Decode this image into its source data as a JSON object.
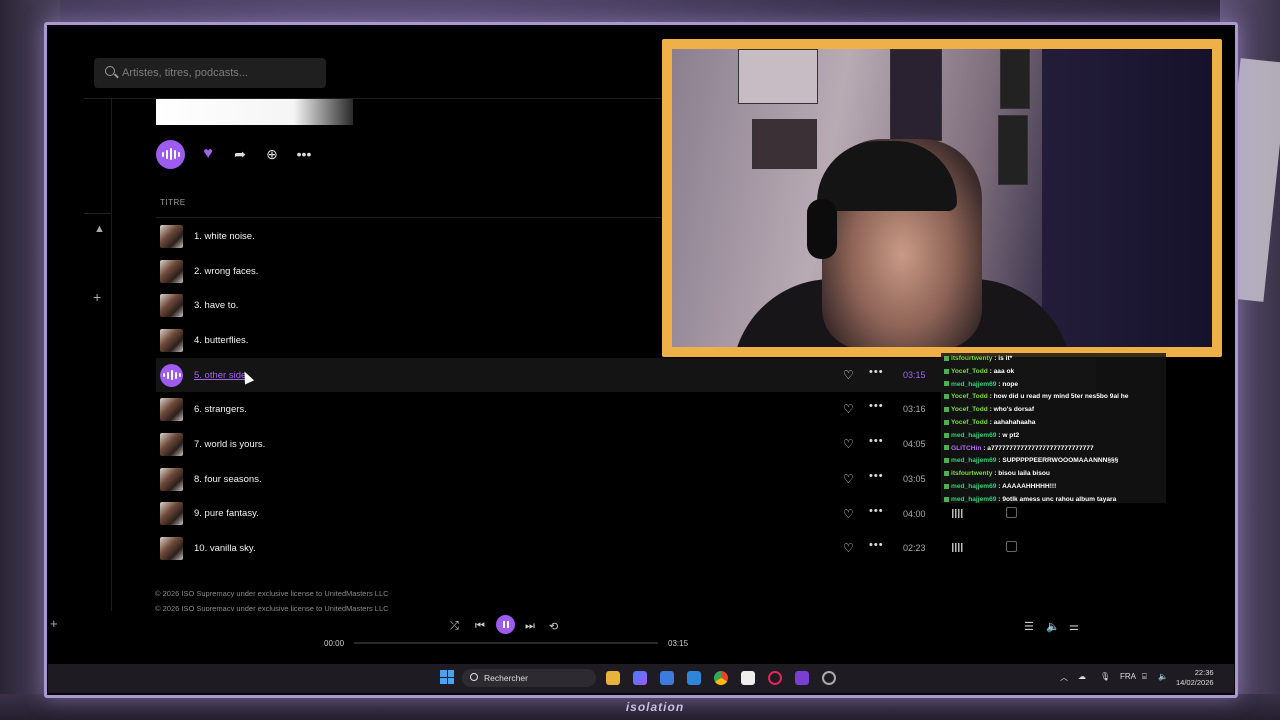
{
  "search": {
    "placeholder": "Artistes, titres, podcasts..."
  },
  "tracklist": {
    "column_title": "TITRE",
    "tracks": [
      {
        "title": "1. white noise.",
        "duration": ""
      },
      {
        "title": "2. wrong faces.",
        "duration": ""
      },
      {
        "title": "3. have to.",
        "duration": ""
      },
      {
        "title": "4. butterflies.",
        "duration": ""
      },
      {
        "title": "5. other side.",
        "duration": "03:15"
      },
      {
        "title": "6. strangers.",
        "duration": "03:16"
      },
      {
        "title": "7. world is yours.",
        "duration": "04:05"
      },
      {
        "title": "8. four seasons.",
        "duration": "03:05"
      },
      {
        "title": "9. pure fantasy.",
        "duration": "04:00"
      },
      {
        "title": "10. vanilla sky.",
        "duration": "02:23"
      }
    ],
    "copyright_1": "© 2026 ISO Supremacy under exclusive license to UnitedMasters LLC",
    "copyright_2": "© 2026 ISO Supremacy under exclusive license to UnitedMasters LLC"
  },
  "player": {
    "elapsed": "00:00",
    "total": "03:15",
    "progress": 0
  },
  "chat": [
    {
      "user": "itsfourtwenty",
      "color": "#7ddc3c",
      "msg": ": is it*"
    },
    {
      "user": "Yocef_Todd",
      "color": "#7ddc3c",
      "msg": ": aaa ok"
    },
    {
      "user": "med_hajjem69",
      "color": "#2fd27a",
      "msg": ": nope"
    },
    {
      "user": "Yocef_Todd",
      "color": "#7ddc3c",
      "msg": ": how did u read my mind 5ter nes5bo 9al he"
    },
    {
      "user": "Yocef_Todd",
      "color": "#7ddc3c",
      "msg": ": who's dorsaf"
    },
    {
      "user": "Yocef_Todd",
      "color": "#7ddc3c",
      "msg": ": aahahahaaha"
    },
    {
      "user": "med_hajjem69",
      "color": "#2fd27a",
      "msg": ": w pt2"
    },
    {
      "user": "GLITCHin",
      "color": "#b06cf5",
      "msg": ": a7777777777777777777777777777"
    },
    {
      "user": "med_hajjem69",
      "color": "#2fd27a",
      "msg": ": SUPPPPPEERRWOOOMAAANNN§§§"
    },
    {
      "user": "itsfourtwenty",
      "color": "#7ddc3c",
      "msg": ": bisou laila bisou"
    },
    {
      "user": "med_hajjem69",
      "color": "#2fd27a",
      "msg": ": AAAAAHHHHH!!!"
    },
    {
      "user": "med_hajjem69",
      "color": "#2fd27a",
      "msg": ": 9otlk amess unc rahou album tayara"
    }
  ],
  "taskbar": {
    "search_label": "Rechercher",
    "lang": "FRA",
    "time": "22:36",
    "date": "14/02/2026"
  },
  "backdrop": {
    "logo_text": "isolation"
  },
  "colors": {
    "accent": "#9e5bf0",
    "cam_border": "#f0b048"
  }
}
